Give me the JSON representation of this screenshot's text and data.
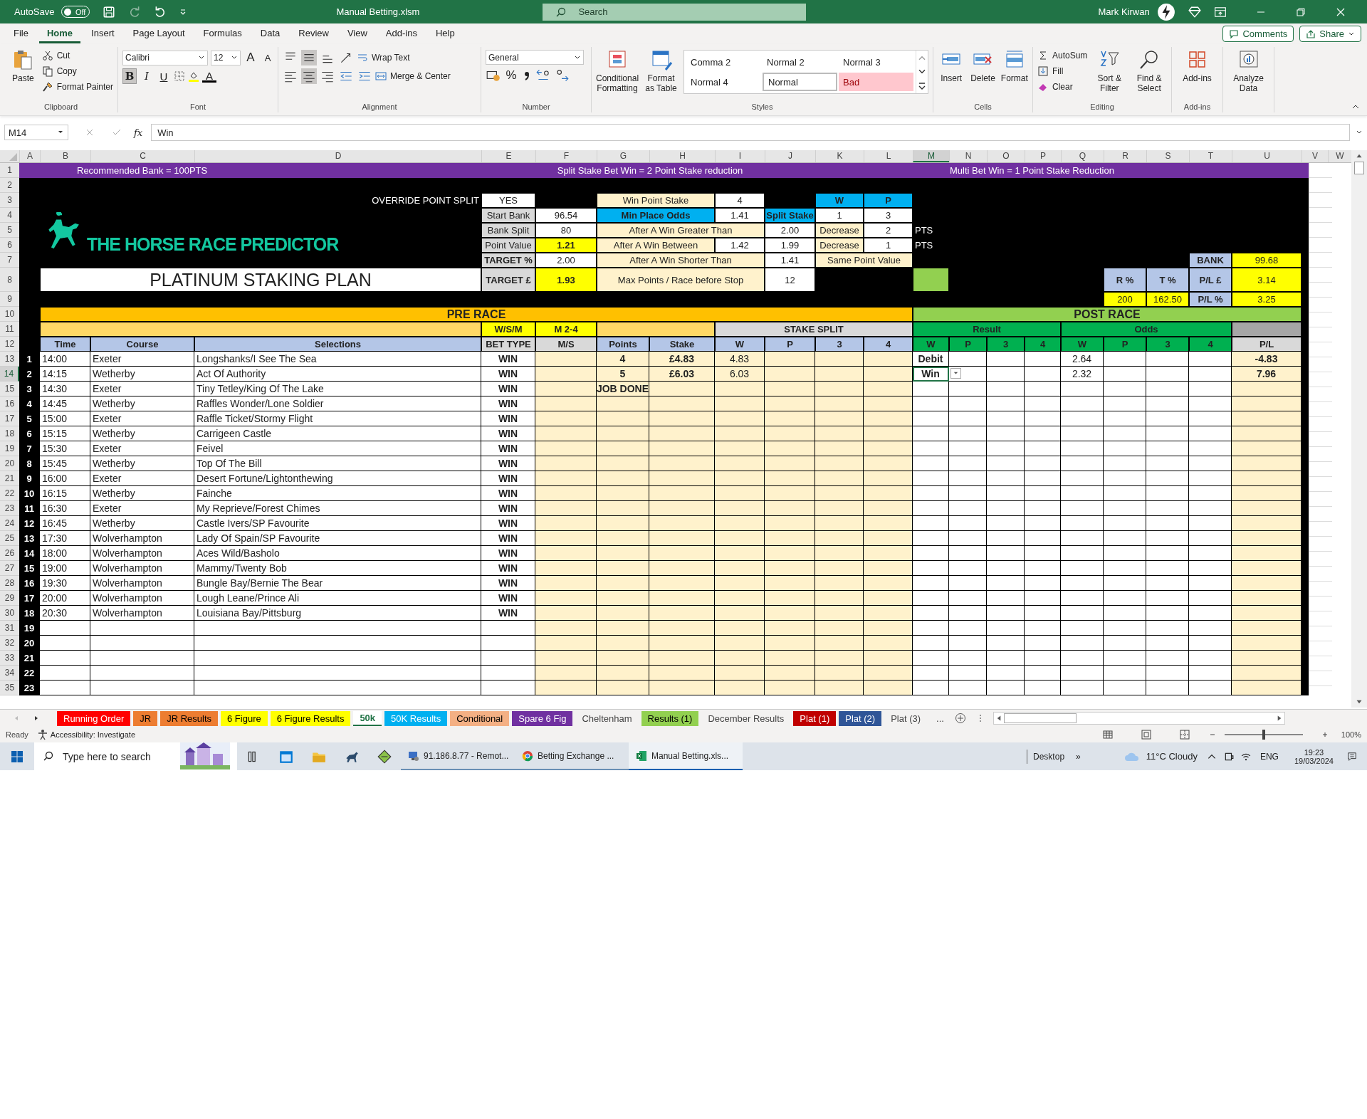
{
  "title_bar": {
    "autosave_label": "AutoSave",
    "autosave": {
      "on": false,
      "label": "Off"
    },
    "file_name": "Manual Betting.xlsm",
    "search": {
      "placeholder": "Search"
    },
    "user": "Mark Kirwan"
  },
  "menu": {
    "tabs": [
      {
        "label": "File",
        "selected": false
      },
      {
        "label": "Home",
        "selected": true
      },
      {
        "label": "Insert",
        "selected": false
      },
      {
        "label": "Page Layout",
        "selected": false
      },
      {
        "label": "Formulas",
        "selected": false
      },
      {
        "label": "Data",
        "selected": false
      },
      {
        "label": "Review",
        "selected": false
      },
      {
        "label": "View",
        "selected": false
      },
      {
        "label": "Add-ins",
        "selected": false
      },
      {
        "label": "Help",
        "selected": false
      }
    ],
    "comments": "Comments",
    "share": "Share"
  },
  "ribbon": {
    "clipboard": {
      "paste": "Paste",
      "cut": "Cut",
      "copy": "Copy",
      "format_painter": "Format Painter",
      "label": "Clipboard"
    },
    "font": {
      "family": "Calibri",
      "size": "12",
      "grow": "A",
      "shrink": "A",
      "bold": {
        "label": "B",
        "on": true
      },
      "italic": "I",
      "underline": "U",
      "color_letter": "A",
      "label": "Font"
    },
    "alignment": {
      "vertical": [
        {
          "on": false
        },
        {
          "on": true
        },
        {
          "on": false
        }
      ],
      "horizontal": [
        {
          "on": false
        },
        {
          "on": true
        },
        {
          "on": false
        }
      ],
      "wrap_text": "Wrap Text",
      "merge_center": "Merge & Center",
      "label": "Alignment"
    },
    "number": {
      "format": "General",
      "percent": "%",
      "label": "Number"
    },
    "styles": {
      "conditional_formatting": "Conditional Formatting",
      "format_as_table": "Format as Table",
      "gallery": [
        {
          "label": "Comma 2",
          "kind": "plain"
        },
        {
          "label": "Normal 2",
          "kind": "plain"
        },
        {
          "label": "Normal 3",
          "kind": "plain"
        },
        {
          "label": "Normal 4",
          "kind": "plain"
        },
        {
          "label": "Normal",
          "kind": "framed"
        },
        {
          "label": "Bad",
          "kind": "bad"
        }
      ],
      "label": "Styles"
    },
    "cells": {
      "insert": "Insert",
      "delete": "Delete",
      "format": "Format",
      "label": "Cells"
    },
    "editing": {
      "autosum": "AutoSum",
      "fill": "Fill",
      "clear": "Clear",
      "sort_filter": "Sort & Filter",
      "find_select": "Find & Select",
      "label": "Editing"
    },
    "addins": {
      "button": "Add-ins",
      "label": "Add-ins"
    },
    "analyze": {
      "button": "Analyze Data"
    }
  },
  "formula_bar": {
    "name_box": "M14",
    "fx": "fx",
    "value": "Win"
  },
  "sheet": {
    "columns": [
      {
        "label": "A",
        "selected": false
      },
      {
        "label": "B",
        "selected": false
      },
      {
        "label": "C",
        "selected": false
      },
      {
        "label": "D",
        "selected": false
      },
      {
        "label": "E",
        "selected": false
      },
      {
        "label": "F",
        "selected": false
      },
      {
        "label": "G",
        "selected": false
      },
      {
        "label": "H",
        "selected": false
      },
      {
        "label": "I",
        "selected": false
      },
      {
        "label": "J",
        "selected": false
      },
      {
        "label": "K",
        "selected": false
      },
      {
        "label": "L",
        "selected": false
      },
      {
        "label": "M",
        "selected": true
      },
      {
        "label": "N",
        "selected": false
      },
      {
        "label": "O",
        "selected": false
      },
      {
        "label": "P",
        "selected": false
      },
      {
        "label": "Q",
        "selected": false
      },
      {
        "label": "R",
        "selected": false
      },
      {
        "label": "S",
        "selected": false
      },
      {
        "label": "T",
        "selected": false
      },
      {
        "label": "U",
        "selected": false
      },
      {
        "label": "V",
        "selected": false
      },
      {
        "label": "W",
        "selected": false
      }
    ],
    "rows": [
      {
        "label": "1",
        "selected": false
      },
      {
        "label": "2",
        "selected": false
      },
      {
        "label": "3",
        "selected": false
      },
      {
        "label": "4",
        "selected": false
      },
      {
        "label": "5",
        "selected": false
      },
      {
        "label": "6",
        "selected": false
      },
      {
        "label": "7",
        "selected": false
      },
      {
        "label": "8",
        "selected": false
      },
      {
        "label": "9",
        "selected": false
      },
      {
        "label": "10",
        "selected": false
      },
      {
        "label": "11",
        "selected": false
      },
      {
        "label": "12",
        "selected": false
      },
      {
        "label": "13",
        "selected": false
      },
      {
        "label": "14",
        "selected": true
      },
      {
        "label": "15",
        "selected": false
      },
      {
        "label": "16",
        "selected": false
      },
      {
        "label": "17",
        "selected": false
      },
      {
        "label": "18",
        "selected": false
      },
      {
        "label": "19",
        "selected": false
      },
      {
        "label": "20",
        "selected": false
      },
      {
        "label": "21",
        "selected": false
      },
      {
        "label": "22",
        "selected": false
      },
      {
        "label": "23",
        "selected": false
      },
      {
        "label": "24",
        "selected": false
      },
      {
        "label": "25",
        "selected": false
      },
      {
        "label": "26",
        "selected": false
      },
      {
        "label": "27",
        "selected": false
      },
      {
        "label": "28",
        "selected": false
      },
      {
        "label": "29",
        "selected": false
      },
      {
        "label": "30",
        "selected": false
      },
      {
        "label": "31",
        "selected": false
      },
      {
        "label": "32",
        "selected": false
      },
      {
        "label": "33",
        "selected": false
      },
      {
        "label": "34",
        "selected": false
      },
      {
        "label": "35",
        "selected": false
      }
    ],
    "cells": [
      {
        "kind": "bar"
      },
      {
        "kind": "banner",
        "text": "Recommended Bank = 100PTS"
      },
      {
        "kind": "bannermid",
        "text": "Split Stake Bet Win = 2 Point Stake reduction"
      },
      {
        "kind": "banner",
        "text": "Multi Bet Win = 1 Point  Stake Reduction"
      },
      {
        "kind": "caption",
        "text": "OVERRIDE POINT SPLIT"
      },
      {
        "kind": "input",
        "text": "YES"
      },
      {
        "kind": "note",
        "text": "Win Point Stake"
      },
      {
        "kind": "input",
        "text": "4"
      },
      {
        "kind": "accent",
        "text": "W"
      },
      {
        "kind": "accent",
        "text": "P"
      },
      {
        "kind": "logo",
        "text": "THE HORSE RACE PREDICTOR"
      },
      {
        "kind": "label",
        "text": "Start Bank"
      },
      {
        "kind": "input",
        "text": "96.54"
      },
      {
        "kind": "accent",
        "text": "Min Place Odds"
      },
      {
        "kind": "input",
        "text": "1.41"
      },
      {
        "kind": "accent",
        "text": "Split Stake"
      },
      {
        "kind": "input",
        "text": "1"
      },
      {
        "kind": "input",
        "text": "3"
      },
      {
        "kind": "label",
        "text": "Bank Split"
      },
      {
        "kind": "input",
        "text": "80"
      },
      {
        "kind": "note",
        "text": "After A Win Greater Than"
      },
      {
        "kind": "input",
        "text": "2.00"
      },
      {
        "kind": "note",
        "text": "Decrease"
      },
      {
        "kind": "input",
        "text": "2"
      },
      {
        "kind": "pts",
        "text": "PTS"
      },
      {
        "kind": "label",
        "text": "Point Value"
      },
      {
        "kind": "highlight",
        "text": "1.21"
      },
      {
        "kind": "note",
        "text": "After A Win Between"
      },
      {
        "kind": "input",
        "text": "1.42"
      },
      {
        "kind": "input",
        "text": "1.99"
      },
      {
        "kind": "note",
        "text": "Decrease"
      },
      {
        "kind": "input",
        "text": "1"
      },
      {
        "kind": "pts",
        "text": "PTS"
      },
      {
        "kind": "key",
        "text": "TARGET %"
      },
      {
        "kind": "input",
        "text": "2.00"
      },
      {
        "kind": "note",
        "text": "After A Win Shorter Than"
      },
      {
        "kind": "input",
        "text": "1.41"
      },
      {
        "kind": "note",
        "text": "Same Point Value"
      },
      {
        "kind": "heading",
        "text": "BANK"
      },
      {
        "kind": "value",
        "text": "99.68"
      },
      {
        "kind": "title",
        "text": "PLATINUM STAKING PLAN"
      },
      {
        "kind": "key",
        "text": "TARGET £"
      },
      {
        "kind": "highlight",
        "text": "1.93"
      },
      {
        "kind": "note",
        "text": "Max Points / Race before Stop"
      },
      {
        "kind": "input",
        "text": "12"
      },
      {
        "kind": "signal"
      },
      {
        "kind": "heading",
        "text": "R %"
      },
      {
        "kind": "heading",
        "text": "T %"
      },
      {
        "kind": "heading",
        "text": "P/L  £"
      },
      {
        "kind": "value",
        "text": "3.14"
      },
      {
        "kind": "value",
        "text": "200"
      },
      {
        "kind": "value",
        "text": "162.50"
      },
      {
        "kind": "heading",
        "text": "P/L %"
      },
      {
        "kind": "value",
        "text": "3.25"
      },
      {
        "kind": "section",
        "text": "PRE RACE"
      },
      {
        "kind": "sectiongreen",
        "text": "POST RACE"
      },
      {
        "kind": "band"
      },
      {
        "kind": "marker",
        "text": "W/S/M"
      },
      {
        "kind": "marker",
        "text": "M 2-4"
      },
      {
        "kind": "band"
      },
      {
        "kind": "neutral",
        "text": "STAKE SPLIT"
      },
      {
        "kind": "result",
        "text": "Result"
      },
      {
        "kind": "result",
        "text": "Odds"
      },
      {
        "kind": "shade"
      },
      {
        "kind": "heading",
        "text": "Time"
      },
      {
        "kind": "heading",
        "text": "Course"
      },
      {
        "kind": "heading",
        "text": "Selections"
      },
      {
        "kind": "neutral",
        "text": "BET TYPE"
      },
      {
        "kind": "neutral",
        "text": "M/S"
      },
      {
        "kind": "heading",
        "text": "Points"
      },
      {
        "kind": "heading",
        "text": "Stake"
      },
      {
        "kind": "heading",
        "text": "W"
      },
      {
        "kind": "heading",
        "text": "P"
      },
      {
        "kind": "heading",
        "text": "3"
      },
      {
        "kind": "heading",
        "text": "4"
      },
      {
        "kind": "result",
        "text": "W"
      },
      {
        "kind": "result",
        "text": "P"
      },
      {
        "kind": "result",
        "text": "3"
      },
      {
        "kind": "result",
        "text": "4"
      },
      {
        "kind": "result",
        "text": "W"
      },
      {
        "kind": "result",
        "text": "P"
      },
      {
        "kind": "result",
        "text": "3"
      },
      {
        "kind": "result",
        "text": "4"
      },
      {
        "kind": "neutral",
        "text": "P/L"
      }
    ],
    "data": [
      {
        "index": "1",
        "time": "14:00",
        "course": "Exeter",
        "selection": "Longshanks/I See The Sea",
        "bet_type": "WIN",
        "points": "4",
        "stake": "£4.83",
        "stake_w": "4.83",
        "result_w": "Debit",
        "odds_w": "2.64",
        "pl": "-4.83",
        "selected": false
      },
      {
        "index": "2",
        "time": "14:15",
        "course": "Wetherby",
        "selection": "Act Of Authority",
        "bet_type": "WIN",
        "points": "5",
        "stake": "£6.03",
        "stake_w": "6.03",
        "result_w": "Win",
        "odds_w": "2.32",
        "pl": "7.96",
        "selected": true
      },
      {
        "index": "3",
        "time": "14:30",
        "course": "Exeter",
        "selection": "Tiny Tetley/King Of The Lake",
        "bet_type": "WIN",
        "points": "JOB DONE",
        "selected": false
      },
      {
        "index": "4",
        "time": "14:45",
        "course": "Wetherby",
        "selection": "Raffles Wonder/Lone Soldier",
        "bet_type": "WIN",
        "selected": false
      },
      {
        "index": "5",
        "time": "15:00",
        "course": "Exeter",
        "selection": "Raffle Ticket/Stormy Flight",
        "bet_type": "WIN",
        "selected": false
      },
      {
        "index": "6",
        "time": "15:15",
        "course": "Wetherby",
        "selection": "Carrigeen Castle",
        "bet_type": "WIN",
        "selected": false
      },
      {
        "index": "7",
        "time": "15:30",
        "course": "Exeter",
        "selection": "Feivel",
        "bet_type": "WIN",
        "selected": false
      },
      {
        "index": "8",
        "time": "15:45",
        "course": "Wetherby",
        "selection": "Top Of The Bill",
        "bet_type": "WIN",
        "selected": false
      },
      {
        "index": "9",
        "time": "16:00",
        "course": "Exeter",
        "selection": "Desert Fortune/Lightonthewing",
        "bet_type": "WIN",
        "selected": false
      },
      {
        "index": "10",
        "time": "16:15",
        "course": "Wetherby",
        "selection": "Fainche",
        "bet_type": "WIN",
        "selected": false
      },
      {
        "index": "11",
        "time": "16:30",
        "course": "Exeter",
        "selection": "My Reprieve/Forest Chimes",
        "bet_type": "WIN",
        "selected": false
      },
      {
        "index": "12",
        "time": "16:45",
        "course": "Wetherby",
        "selection": "Castle Ivers/SP Favourite",
        "bet_type": "WIN",
        "selected": false
      },
      {
        "index": "13",
        "time": "17:30",
        "course": "Wolverhampton",
        "selection": "Lady Of Spain/SP Favourite",
        "bet_type": "WIN",
        "selected": false
      },
      {
        "index": "14",
        "time": "18:00",
        "course": "Wolverhampton",
        "selection": "Aces Wild/Basholo",
        "bet_type": "WIN",
        "selected": false
      },
      {
        "index": "15",
        "time": "19:00",
        "course": "Wolverhampton",
        "selection": "Mammy/Twenty Bob",
        "bet_type": "WIN",
        "selected": false
      },
      {
        "index": "16",
        "time": "19:30",
        "course": "Wolverhampton",
        "selection": "Bungle Bay/Bernie The Bear",
        "bet_type": "WIN",
        "selected": false
      },
      {
        "index": "17",
        "time": "20:00",
        "course": "Wolverhampton",
        "selection": "Lough Leane/Prince Ali",
        "bet_type": "WIN",
        "selected": false
      },
      {
        "index": "18",
        "time": "20:30",
        "course": "Wolverhampton",
        "selection": "Louisiana Bay/Pittsburg",
        "bet_type": "WIN",
        "selected": false
      },
      {
        "index": "19",
        "selected": false
      },
      {
        "index": "20",
        "selected": false
      },
      {
        "index": "21",
        "selected": false
      },
      {
        "index": "22",
        "selected": false
      },
      {
        "index": "23",
        "selected": false
      }
    ]
  },
  "sheet_tabs": [
    {
      "label": "Running Order",
      "color": "#ff0000",
      "selected": false
    },
    {
      "label": "JR",
      "color": "#ed7d31",
      "selected": false
    },
    {
      "label": "JR Results",
      "color": "#ed7d31",
      "selected": false
    },
    {
      "label": "6 Figure",
      "color": "#ffff00",
      "selected": false
    },
    {
      "label": "6 Figure Results",
      "color": "#ffff00",
      "selected": false
    },
    {
      "label": "50k",
      "selected": true
    },
    {
      "label": "50K Results",
      "color": "#00b0f0",
      "selected": false
    },
    {
      "label": "Conditional",
      "color": "#f4b084",
      "selected": false
    },
    {
      "label": "Spare 6 Fig",
      "color": "#7030a0",
      "selected": false
    },
    {
      "label": "Cheltenham",
      "selected": false
    },
    {
      "label": "Results (1)",
      "color": "#92d050",
      "selected": false
    },
    {
      "label": "December Results",
      "selected": false
    },
    {
      "label": "Plat (1)",
      "color": "#c00000",
      "selected": false
    },
    {
      "label": "Plat (2)",
      "color": "#2f5597",
      "selected": false
    },
    {
      "label": "Plat (3)",
      "selected": false
    }
  ],
  "more_tabs": "...",
  "status_bar": {
    "ready": "Ready",
    "accessibility": "Accessibility: Investigate",
    "zoom": "100%",
    "level": 0.5
  },
  "taskbar": {
    "search": {
      "placeholder": "Type here to search"
    },
    "apps": [
      {
        "label": "91.186.8.77 - Remot...",
        "kind": "remote",
        "selected": false
      },
      {
        "label": "Betting Exchange ...",
        "kind": "browser",
        "selected": false
      },
      {
        "label": "Manual Betting.xls...",
        "kind": "excel",
        "selected": true
      }
    ],
    "desktop": "Desktop",
    "chevron": "»",
    "weather": "11°C  Cloudy",
    "language": "ENG",
    "time": "19:23",
    "date": "19/03/2024"
  }
}
